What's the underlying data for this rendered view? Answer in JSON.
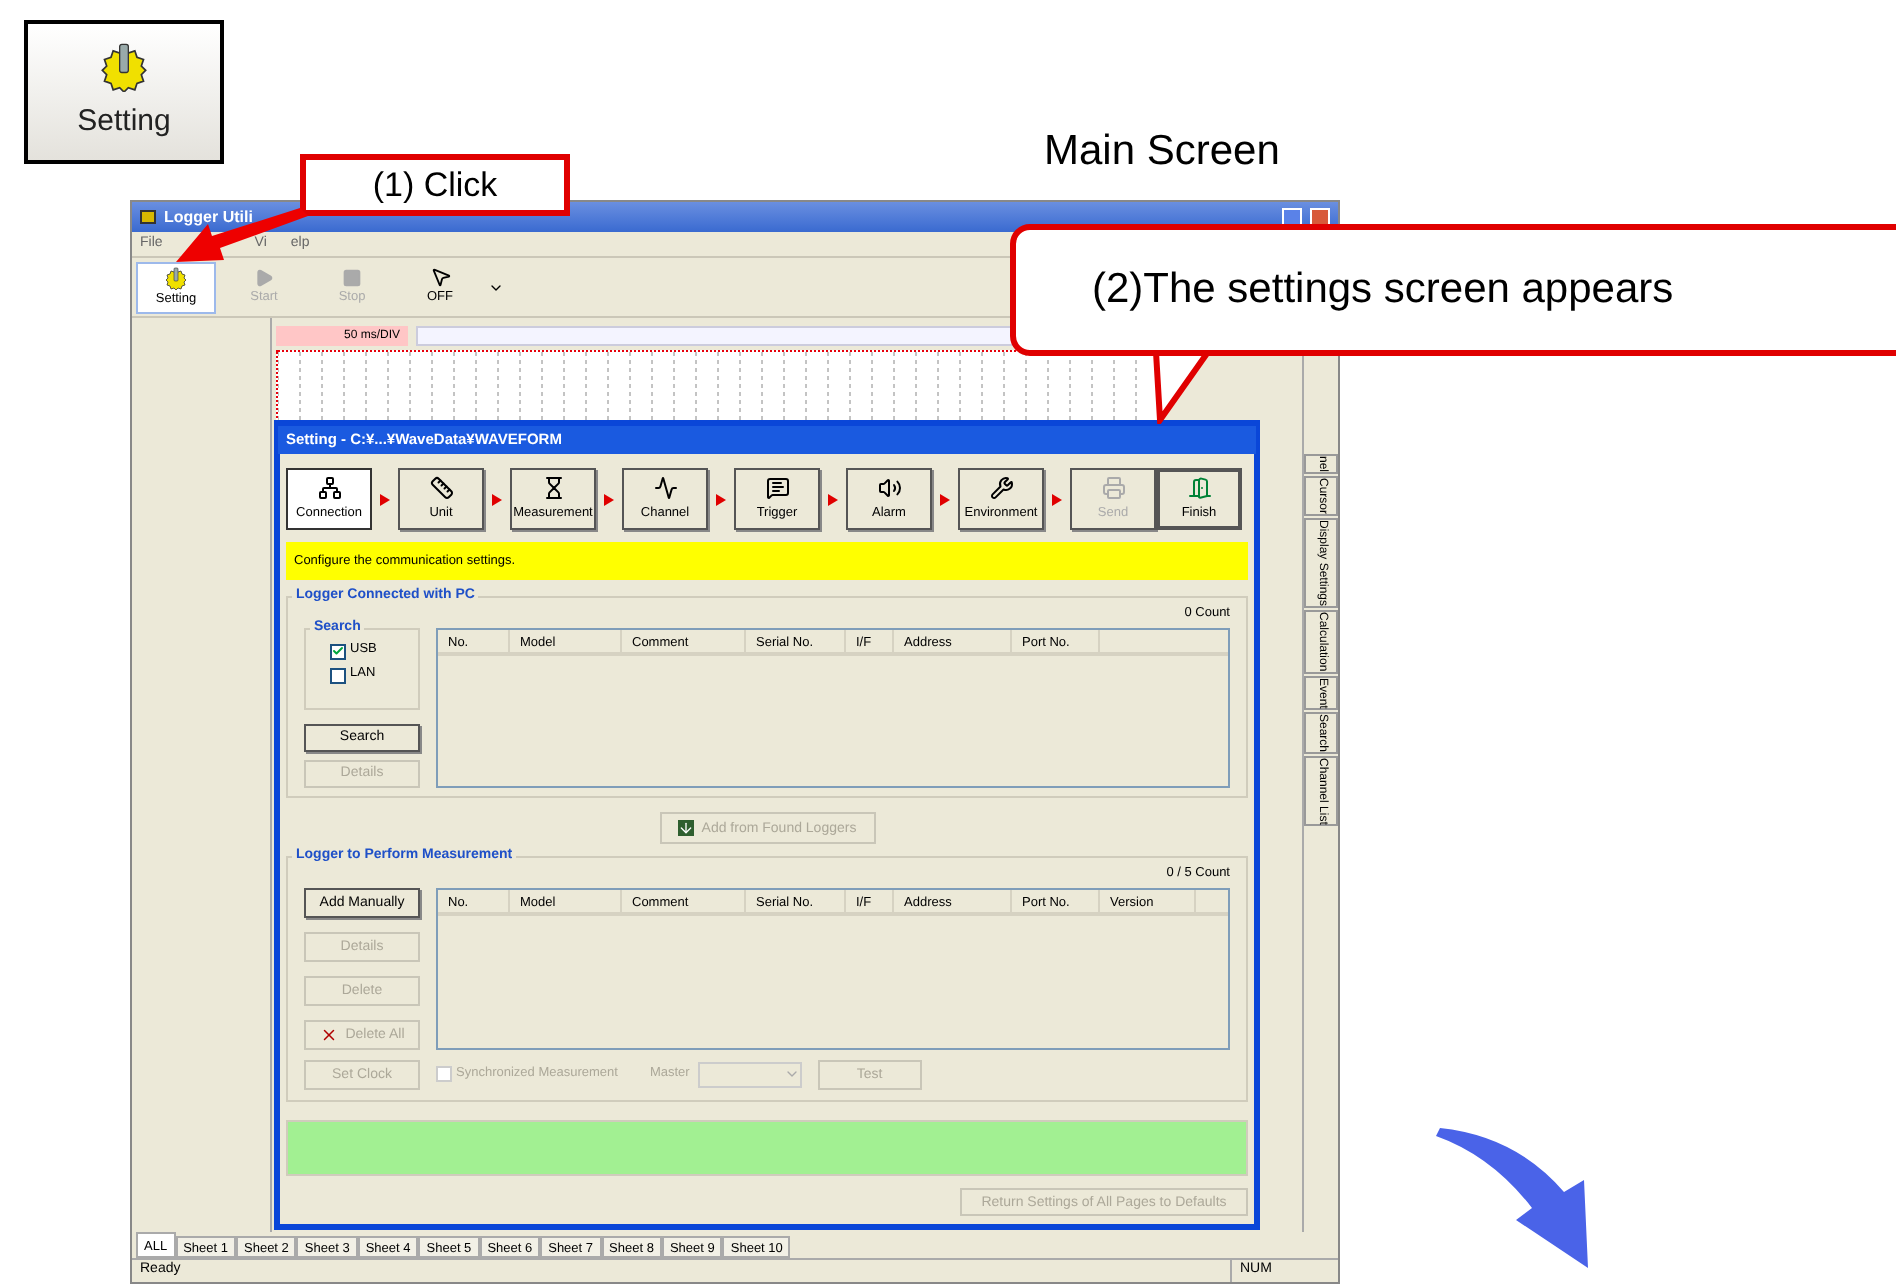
{
  "setting_icon_button": {
    "label": "Setting"
  },
  "caption": "Main Screen",
  "callouts": [
    {
      "text": "(1) Click"
    },
    {
      "text": "(2)The settings screen appears"
    }
  ],
  "main_window": {
    "title": "Logger Utili",
    "menu": [
      "File",
      "Vi",
      "elp"
    ],
    "toolbar": [
      {
        "label": "Setting",
        "selected": true,
        "disabled": false
      },
      {
        "label": "Start",
        "selected": false,
        "disabled": true
      },
      {
        "label": "Stop",
        "selected": false,
        "disabled": true
      },
      {
        "label": "OFF",
        "selected": false,
        "disabled": false
      }
    ],
    "time_scale": "50 ms/DIV",
    "side_tabs": [
      "nel",
      "Cursor",
      "Display Settings",
      "Calculation",
      "Event",
      "Search",
      "Channel List"
    ],
    "sheet_tabs": [
      {
        "label": "ALL",
        "selected": true
      },
      {
        "label": "Sheet 1",
        "selected": false
      },
      {
        "label": "Sheet 2",
        "selected": false
      },
      {
        "label": "Sheet 3",
        "selected": false
      },
      {
        "label": "Sheet 4",
        "selected": false
      },
      {
        "label": "Sheet 5",
        "selected": false
      },
      {
        "label": "Sheet 6",
        "selected": false
      },
      {
        "label": "Sheet 7",
        "selected": false
      },
      {
        "label": "Sheet 8",
        "selected": false
      },
      {
        "label": "Sheet 9",
        "selected": false
      },
      {
        "label": "Sheet 10",
        "selected": false
      }
    ],
    "status": "Ready",
    "indicator": "NUM"
  },
  "dialog": {
    "title": "Setting - C:¥...¥WaveData¥WAVEFORM",
    "steps": [
      {
        "label": "Connection",
        "selected": true,
        "disabled": false
      },
      {
        "label": "Unit",
        "selected": false,
        "disabled": false
      },
      {
        "label": "Measurement",
        "selected": false,
        "disabled": false
      },
      {
        "label": "Channel",
        "selected": false,
        "disabled": false
      },
      {
        "label": "Trigger",
        "selected": false,
        "disabled": false
      },
      {
        "label": "Alarm",
        "selected": false,
        "disabled": false
      },
      {
        "label": "Environment",
        "selected": false,
        "disabled": false
      },
      {
        "label": "Send",
        "selected": false,
        "disabled": true
      }
    ],
    "finish": "Finish",
    "message": "Configure the communication settings.",
    "connected": {
      "title": "Logger Connected with PC",
      "count": "0 Count",
      "search_group": "Search",
      "options": [
        {
          "label": "USB",
          "checked": true
        },
        {
          "label": "LAN",
          "checked": false
        }
      ],
      "buttons": [
        {
          "label": "Search",
          "disabled": false
        },
        {
          "label": "Details",
          "disabled": true
        }
      ],
      "columns": [
        "No.",
        "Model",
        "Comment",
        "Serial No.",
        "I/F",
        "Address",
        "Port No."
      ]
    },
    "add_found": {
      "label": "Add from Found Loggers",
      "disabled": true
    },
    "measurement": {
      "title": "Logger to Perform Measurement",
      "count": "0 / 5 Count",
      "buttons": [
        {
          "label": "Add Manually",
          "disabled": false,
          "kind": "plain"
        },
        {
          "label": "Details",
          "disabled": true,
          "kind": "plain"
        },
        {
          "label": "Delete",
          "disabled": true,
          "kind": "plain"
        },
        {
          "label": "Delete All",
          "disabled": true,
          "kind": "delete"
        },
        {
          "label": "Set Clock",
          "disabled": true,
          "kind": "plain"
        }
      ],
      "columns": [
        "No.",
        "Model",
        "Comment",
        "Serial No.",
        "I/F",
        "Address",
        "Port No.",
        "Version"
      ],
      "sync": {
        "label": "Synchronized Measurement",
        "checked": false,
        "disabled": true
      },
      "master_label": "Master",
      "test": {
        "label": "Test",
        "disabled": true
      }
    },
    "reset": {
      "label": "Return Settings of All Pages to Defaults",
      "disabled": true
    }
  }
}
